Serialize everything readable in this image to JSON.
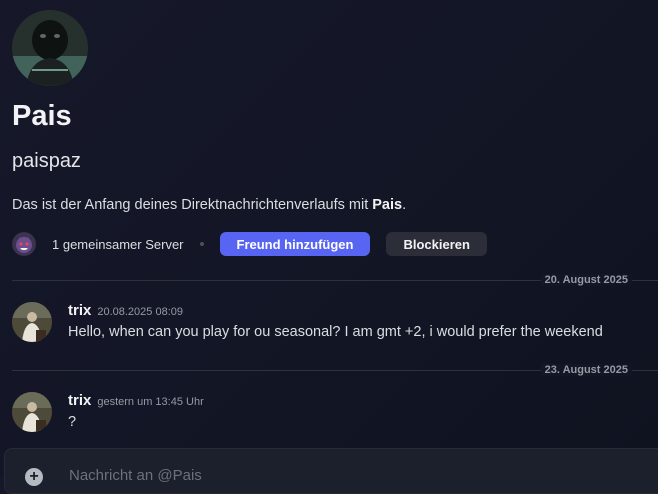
{
  "profile": {
    "display_name": "Pais",
    "username": "paispaz",
    "intro_prefix": "Das ist der Anfang deines Direktnachrichtenverlaufs mit ",
    "intro_name": "Pais",
    "intro_suffix": ".",
    "mutual_servers": "1 gemeinsamer Server",
    "add_friend_label": "Freund hinzufügen",
    "block_label": "Blockieren",
    "accent_color": "#5865f2"
  },
  "messages": [
    {
      "divider": "20. August 2025",
      "author": "trix",
      "timestamp": "20.08.2025 08:09",
      "content": "Hello, when can you play for ou seasonal? I am gmt +2, i would prefer the weekend"
    },
    {
      "divider": "23. August 2025",
      "author": "trix",
      "timestamp": "gestern um 13:45 Uhr",
      "content": "?"
    }
  ],
  "composer": {
    "placeholder": "Nachricht an @Pais",
    "add_icon": "plus-circle-icon"
  }
}
